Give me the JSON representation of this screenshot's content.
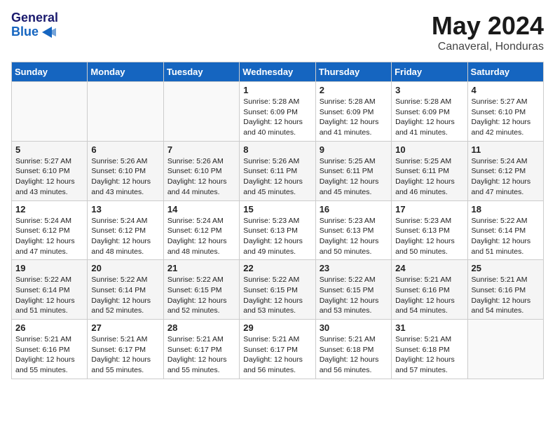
{
  "header": {
    "logo_line1": "General",
    "logo_line2": "Blue",
    "month_title": "May 2024",
    "location": "Canaveral, Honduras"
  },
  "weekdays": [
    "Sunday",
    "Monday",
    "Tuesday",
    "Wednesday",
    "Thursday",
    "Friday",
    "Saturday"
  ],
  "weeks": [
    [
      {
        "day": "",
        "info": ""
      },
      {
        "day": "",
        "info": ""
      },
      {
        "day": "",
        "info": ""
      },
      {
        "day": "1",
        "info": "Sunrise: 5:28 AM\nSunset: 6:09 PM\nDaylight: 12 hours\nand 40 minutes."
      },
      {
        "day": "2",
        "info": "Sunrise: 5:28 AM\nSunset: 6:09 PM\nDaylight: 12 hours\nand 41 minutes."
      },
      {
        "day": "3",
        "info": "Sunrise: 5:28 AM\nSunset: 6:09 PM\nDaylight: 12 hours\nand 41 minutes."
      },
      {
        "day": "4",
        "info": "Sunrise: 5:27 AM\nSunset: 6:10 PM\nDaylight: 12 hours\nand 42 minutes."
      }
    ],
    [
      {
        "day": "5",
        "info": "Sunrise: 5:27 AM\nSunset: 6:10 PM\nDaylight: 12 hours\nand 43 minutes."
      },
      {
        "day": "6",
        "info": "Sunrise: 5:26 AM\nSunset: 6:10 PM\nDaylight: 12 hours\nand 43 minutes."
      },
      {
        "day": "7",
        "info": "Sunrise: 5:26 AM\nSunset: 6:10 PM\nDaylight: 12 hours\nand 44 minutes."
      },
      {
        "day": "8",
        "info": "Sunrise: 5:26 AM\nSunset: 6:11 PM\nDaylight: 12 hours\nand 45 minutes."
      },
      {
        "day": "9",
        "info": "Sunrise: 5:25 AM\nSunset: 6:11 PM\nDaylight: 12 hours\nand 45 minutes."
      },
      {
        "day": "10",
        "info": "Sunrise: 5:25 AM\nSunset: 6:11 PM\nDaylight: 12 hours\nand 46 minutes."
      },
      {
        "day": "11",
        "info": "Sunrise: 5:24 AM\nSunset: 6:12 PM\nDaylight: 12 hours\nand 47 minutes."
      }
    ],
    [
      {
        "day": "12",
        "info": "Sunrise: 5:24 AM\nSunset: 6:12 PM\nDaylight: 12 hours\nand 47 minutes."
      },
      {
        "day": "13",
        "info": "Sunrise: 5:24 AM\nSunset: 6:12 PM\nDaylight: 12 hours\nand 48 minutes."
      },
      {
        "day": "14",
        "info": "Sunrise: 5:24 AM\nSunset: 6:12 PM\nDaylight: 12 hours\nand 48 minutes."
      },
      {
        "day": "15",
        "info": "Sunrise: 5:23 AM\nSunset: 6:13 PM\nDaylight: 12 hours\nand 49 minutes."
      },
      {
        "day": "16",
        "info": "Sunrise: 5:23 AM\nSunset: 6:13 PM\nDaylight: 12 hours\nand 50 minutes."
      },
      {
        "day": "17",
        "info": "Sunrise: 5:23 AM\nSunset: 6:13 PM\nDaylight: 12 hours\nand 50 minutes."
      },
      {
        "day": "18",
        "info": "Sunrise: 5:22 AM\nSunset: 6:14 PM\nDaylight: 12 hours\nand 51 minutes."
      }
    ],
    [
      {
        "day": "19",
        "info": "Sunrise: 5:22 AM\nSunset: 6:14 PM\nDaylight: 12 hours\nand 51 minutes."
      },
      {
        "day": "20",
        "info": "Sunrise: 5:22 AM\nSunset: 6:14 PM\nDaylight: 12 hours\nand 52 minutes."
      },
      {
        "day": "21",
        "info": "Sunrise: 5:22 AM\nSunset: 6:15 PM\nDaylight: 12 hours\nand 52 minutes."
      },
      {
        "day": "22",
        "info": "Sunrise: 5:22 AM\nSunset: 6:15 PM\nDaylight: 12 hours\nand 53 minutes."
      },
      {
        "day": "23",
        "info": "Sunrise: 5:22 AM\nSunset: 6:15 PM\nDaylight: 12 hours\nand 53 minutes."
      },
      {
        "day": "24",
        "info": "Sunrise: 5:21 AM\nSunset: 6:16 PM\nDaylight: 12 hours\nand 54 minutes."
      },
      {
        "day": "25",
        "info": "Sunrise: 5:21 AM\nSunset: 6:16 PM\nDaylight: 12 hours\nand 54 minutes."
      }
    ],
    [
      {
        "day": "26",
        "info": "Sunrise: 5:21 AM\nSunset: 6:16 PM\nDaylight: 12 hours\nand 55 minutes."
      },
      {
        "day": "27",
        "info": "Sunrise: 5:21 AM\nSunset: 6:17 PM\nDaylight: 12 hours\nand 55 minutes."
      },
      {
        "day": "28",
        "info": "Sunrise: 5:21 AM\nSunset: 6:17 PM\nDaylight: 12 hours\nand 55 minutes."
      },
      {
        "day": "29",
        "info": "Sunrise: 5:21 AM\nSunset: 6:17 PM\nDaylight: 12 hours\nand 56 minutes."
      },
      {
        "day": "30",
        "info": "Sunrise: 5:21 AM\nSunset: 6:18 PM\nDaylight: 12 hours\nand 56 minutes."
      },
      {
        "day": "31",
        "info": "Sunrise: 5:21 AM\nSunset: 6:18 PM\nDaylight: 12 hours\nand 57 minutes."
      },
      {
        "day": "",
        "info": ""
      }
    ]
  ]
}
